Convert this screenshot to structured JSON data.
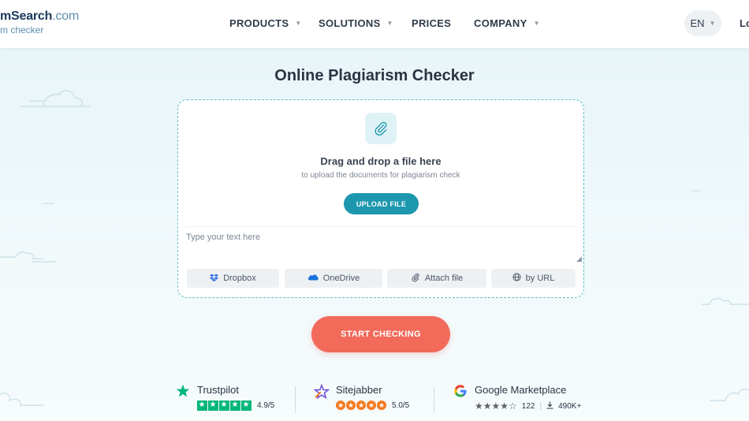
{
  "header": {
    "logo_main": "mSearch",
    "logo_domain": ".com",
    "logo_sub": "m checker",
    "nav": [
      {
        "label": "PRODUCTS",
        "has_dropdown": true
      },
      {
        "label": "SOLUTIONS",
        "has_dropdown": true
      },
      {
        "label": "PRICES",
        "has_dropdown": false
      },
      {
        "label": "COMPANY",
        "has_dropdown": true
      }
    ],
    "language": "EN",
    "login": "Lo"
  },
  "main": {
    "title": "Online Plagiarism Checker",
    "dropzone": {
      "icon": "paperclip-icon",
      "title": "Drag and drop a file here",
      "subtitle": "to upload the documents for plagiarism check",
      "upload_button": "UPLOAD FILE"
    },
    "text_input": {
      "placeholder": "Type your text here",
      "value": ""
    },
    "sources": [
      {
        "label": "Dropbox",
        "icon": "dropbox-icon"
      },
      {
        "label": "OneDrive",
        "icon": "onedrive-icon"
      },
      {
        "label": "Attach file",
        "icon": "paperclip-icon"
      },
      {
        "label": "by URL",
        "icon": "globe-icon"
      }
    ],
    "start_button": "START CHECKING"
  },
  "ratings": [
    {
      "name": "Trustpilot",
      "score": "4.9/5"
    },
    {
      "name": "Sitejabber",
      "score": "5.0/5"
    },
    {
      "name": "Google Marketplace",
      "reviews": "122",
      "installs": "490K+"
    }
  ],
  "colors": {
    "accent_teal": "#1c97ad",
    "start_coral": "#f26a5a",
    "trustpilot_green": "#00b67a",
    "sitejabber_orange": "#f47a20"
  }
}
